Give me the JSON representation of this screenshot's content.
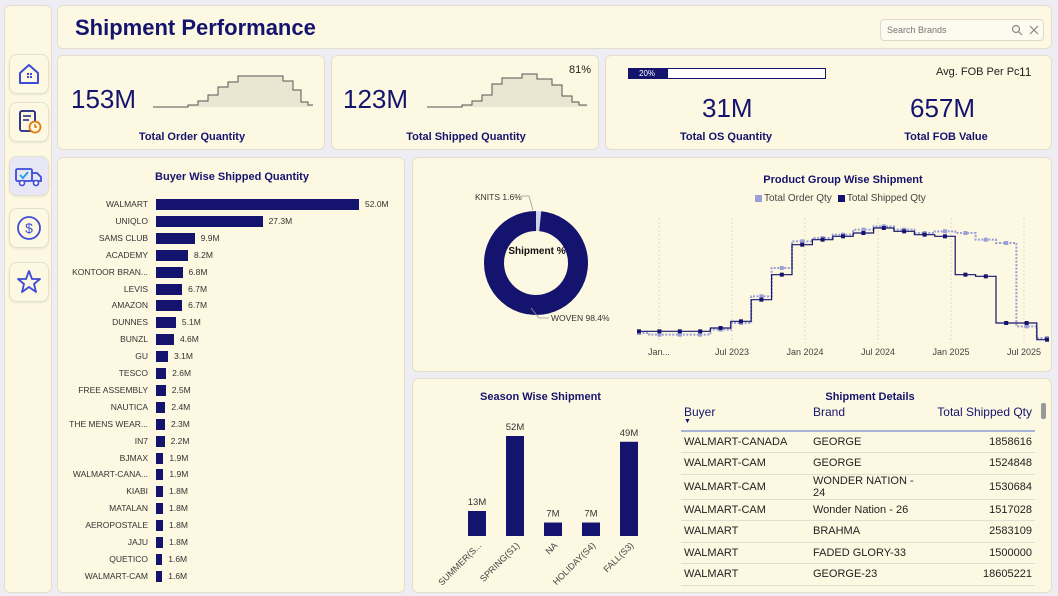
{
  "header": {
    "title": "Shipment Performance",
    "search_placeholder": "Search Brands"
  },
  "nav": [
    "home-icon",
    "report-clock-icon",
    "truck-check-icon",
    "dollar-icon",
    "star-icon"
  ],
  "kpis": {
    "order_qty": {
      "value": "153M",
      "label": "Total Order Quantity"
    },
    "shipped_qty": {
      "value": "123M",
      "label": "Total Shipped Quantity",
      "pct": "81%"
    },
    "os": {
      "progress_label": "20%",
      "progress": 0.2,
      "value": "31M",
      "label": "Total OS Quantity"
    },
    "fob": {
      "avg_label": "Avg. FOB Per Pc",
      "avg_value": "11",
      "value": "657M",
      "label": "Total FOB Value"
    }
  },
  "buyer_chart": {
    "title": "Buyer Wise Shipped Quantity",
    "chart_data": {
      "type": "bar",
      "categories": [
        "WALMART",
        "UNIQLO",
        "SAMS CLUB",
        "ACADEMY",
        "KONTOOR BRAN...",
        "LEVIS",
        "AMAZON",
        "DUNNES",
        "BUNZL",
        "GU",
        "TESCO",
        "FREE ASSEMBLY",
        "NAUTICA",
        "THE MENS WEAR...",
        "IN7",
        "BJMAX",
        "WALMART-CANA...",
        "KIABI",
        "MATALAN",
        "AEROPOSTALE",
        "JAJU",
        "QUETICO",
        "WALMART-CAM"
      ],
      "values": [
        52.0,
        27.3,
        9.9,
        8.2,
        6.8,
        6.7,
        6.7,
        5.1,
        4.6,
        3.1,
        2.6,
        2.5,
        2.4,
        2.3,
        2.2,
        1.9,
        1.9,
        1.8,
        1.8,
        1.8,
        1.8,
        1.6,
        1.6
      ],
      "labels": [
        "52.0M",
        "27.3M",
        "9.9M",
        "8.2M",
        "6.8M",
        "6.7M",
        "6.7M",
        "5.1M",
        "4.6M",
        "3.1M",
        "2.6M",
        "2.5M",
        "2.4M",
        "2.3M",
        "2.2M",
        "1.9M",
        "1.9M",
        "1.8M",
        "1.8M",
        "1.8M",
        "1.8M",
        "1.6M",
        "1.6M"
      ]
    }
  },
  "donut": {
    "center_label": "Shipment %",
    "chart_data": {
      "type": "pie",
      "categories": [
        "KNITS",
        "WOVEN"
      ],
      "values": [
        1.6,
        98.4
      ],
      "labels": [
        "KNITS 1.6%",
        "WOVEN 98.4%"
      ]
    }
  },
  "product_chart": {
    "title": "Product Group Wise Shipment",
    "legend": [
      "Total Order Qty",
      "Total Shipped Qty"
    ],
    "chart_data": {
      "type": "line",
      "x_ticks": [
        "Jan...",
        "Jul 2023",
        "Jan 2024",
        "Jul 2024",
        "Jan 2025",
        "Jul 2025"
      ],
      "series": [
        {
          "name": "Total Order Qty",
          "values": [
            0.06,
            0.05,
            0.05,
            0.05,
            0.08,
            0.12,
            0.28,
            0.45,
            0.61,
            0.63,
            0.65,
            0.68,
            0.7,
            0.68,
            0.66,
            0.67,
            0.66,
            0.62,
            0.6,
            0.1,
            0.03
          ]
        },
        {
          "name": "Total Shipped Qty",
          "values": [
            0.07,
            0.07,
            0.07,
            0.07,
            0.09,
            0.13,
            0.26,
            0.41,
            0.59,
            0.62,
            0.64,
            0.66,
            0.69,
            0.67,
            0.65,
            0.64,
            0.41,
            0.4,
            0.12,
            0.12,
            0.02
          ]
        }
      ]
    }
  },
  "season_chart": {
    "title": "Season Wise Shipment",
    "chart_data": {
      "type": "bar",
      "categories": [
        "SUMMER(S...",
        "SPRING(S1)",
        "NA",
        "HOLIDAY(S4)",
        "FALL(S3)"
      ],
      "values": [
        13,
        52,
        7,
        7,
        49
      ],
      "labels": [
        "13M",
        "52M",
        "7M",
        "7M",
        "49M"
      ]
    }
  },
  "details": {
    "title": "Shipment Details",
    "columns": [
      "Buyer",
      "Brand",
      "Total Shipped Qty"
    ],
    "rows": [
      [
        "WALMART-CANADA",
        "GEORGE",
        "1858616"
      ],
      [
        "WALMART-CAM",
        "GEORGE",
        "1524848"
      ],
      [
        "WALMART-CAM",
        "WONDER NATION - 24",
        "1530684"
      ],
      [
        "WALMART-CAM",
        "Wonder Nation - 26",
        "1517028"
      ],
      [
        "WALMART",
        "BRAHMA",
        "2583109"
      ],
      [
        "WALMART",
        "FADED GLORY-33",
        "1500000"
      ],
      [
        "WALMART",
        "GEORGE-23",
        "18605221"
      ]
    ]
  }
}
